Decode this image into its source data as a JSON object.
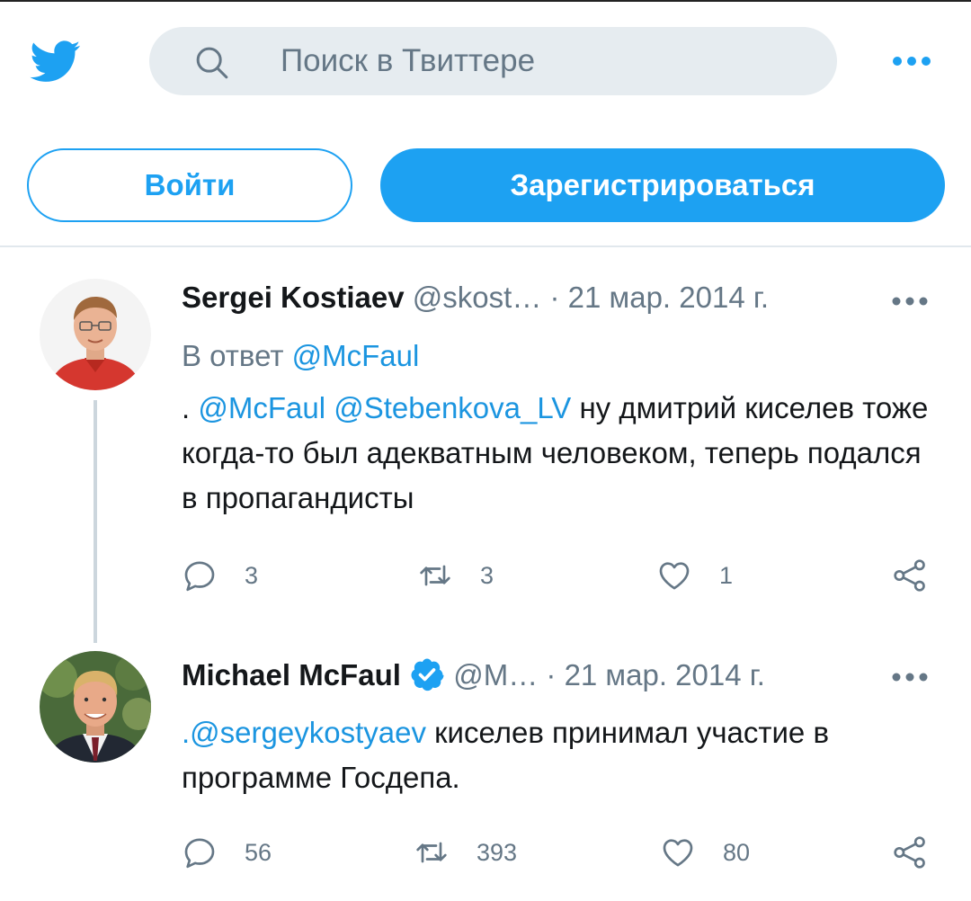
{
  "header": {
    "logo_icon": "twitter-bird-icon",
    "search_placeholder": "Поиск в Твиттере",
    "more_icon": "more-horizontal-icon",
    "login_label": "Войти",
    "signup_label": "Зарегистрироваться",
    "accent_color": "#1da1f2"
  },
  "tweets": [
    {
      "name": "Sergei Kostiaev",
      "handle": "@skost…",
      "sep": " · ",
      "date": "21 мар. 2014 г.",
      "reply_prefix": "В ответ ",
      "reply_to": "@McFaul",
      "text_prefix": ". ",
      "mention1": "@McFaul",
      "mention2": "@Stebenkova_LV",
      "text": " ну дмитрий киселев тоже когда-то был адекватным человеком, теперь подался в пропагандисты",
      "replies": "3",
      "retweets": "3",
      "likes": "1"
    },
    {
      "name": "Michael McFaul",
      "verified_icon": "verified-badge-icon",
      "handle": "@M…",
      "sep": " · ",
      "date": "21 мар. 2014 г.",
      "mention": ".@sergeykostyaev",
      "text": " киселев принимал участие в программе Госдепа.",
      "replies": "56",
      "retweets": "393",
      "likes": "80"
    }
  ]
}
